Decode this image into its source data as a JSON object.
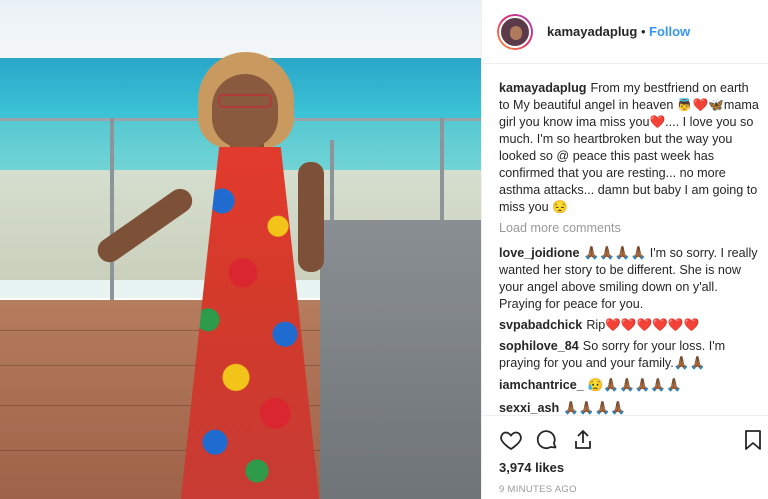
{
  "post": {
    "username": "kamayadaplug",
    "dot": "•",
    "follow_label": "Follow",
    "caption_user": "kamayadaplug",
    "caption_text": "From my bestfriend on earth to My beautiful angel in heaven 👼❤️🦋mama girl you know ima miss you❤️.... I love you so much. I'm so heartbroken but the way you looked so @ peace this past week has confirmed that you are resting... no more asthma attacks... damn but baby I am going to miss you 😔",
    "load_more": "Load more comments",
    "comments": [
      {
        "user": "love_joidione",
        "text": "🙏🏾🙏🏾🙏🏾🙏🏾 I'm so sorry. I really wanted her story to be different. She is now your angel above smiling down on y'all. Praying for peace for you."
      },
      {
        "user": "svpabadchick",
        "text": "Rip❤️❤️❤️❤️❤️❤️"
      },
      {
        "user": "sophilove_84",
        "text": "So sorry for your loss. I'm praying for you and your family.🙏🏾🙏🏾"
      },
      {
        "user": "iamchantrice_",
        "text": "😥🙏🏾🙏🏾🙏🏾🙏🏾🙏🏾"
      },
      {
        "user": "sexxi_ash",
        "text": "🙏🏾🙏🏾🙏🏾🙏🏾"
      }
    ],
    "likes": "3,974 likes",
    "time": "9 MINUTES AGO"
  },
  "icons": [
    "heart-icon",
    "comment-icon",
    "share-icon",
    "bookmark-icon"
  ],
  "colors": {
    "follow": "#3897f0",
    "muted": "#999999",
    "text": "#262626"
  }
}
